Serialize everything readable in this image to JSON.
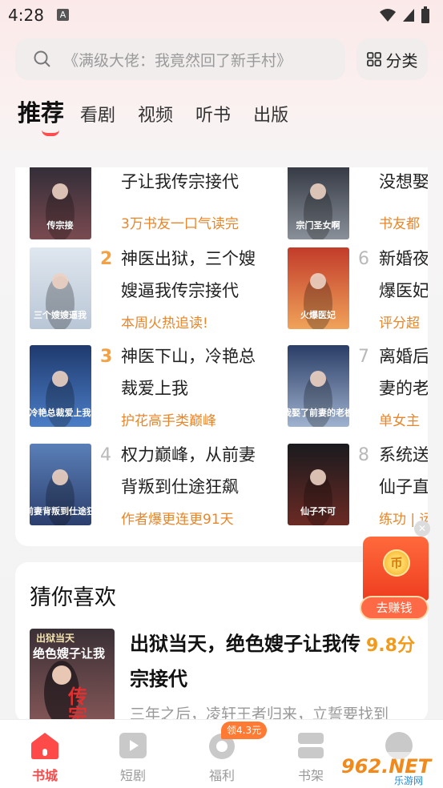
{
  "status": {
    "time": "4:28",
    "notif": "A"
  },
  "search": {
    "placeholder": "《满级大佬：我竟然回了新手村》",
    "category_label": "分类"
  },
  "tabs": [
    {
      "label": "推荐"
    },
    {
      "label": "看剧"
    },
    {
      "label": "视频"
    },
    {
      "label": "听书"
    },
    {
      "label": "出版"
    }
  ],
  "rank_left": [
    {
      "rank": "",
      "title1": "子让我传宗接代",
      "title2": "",
      "tag": "3万书友一口气读完",
      "cover_text": "传宗接",
      "cover_colors": [
        "#2a2a35",
        "#7a4a50"
      ]
    },
    {
      "rank": "2",
      "title1": "神医出狱，三个嫂",
      "title2": "嫂逼我传宗接代",
      "tag": "本周火热追读!",
      "cover_text": "三个嫂嫂逼我",
      "cover_colors": [
        "#dfe7ef",
        "#b9c6d6"
      ]
    },
    {
      "rank": "3",
      "title1": "神医下山，冷艳总",
      "title2": "裁爱上我",
      "tag": "护花高手类巅峰",
      "cover_text": "冷艳总裁爱上我",
      "cover_colors": [
        "#1f3a6e",
        "#4b7ec7"
      ]
    },
    {
      "rank": "4",
      "title1": "权力巅峰，从前妻",
      "title2": "背叛到仕途狂飙",
      "tag": "作者爆更连更91天",
      "cover_text": "从前妻背叛到仕途狂飙",
      "cover_colors": [
        "#5a7fb8",
        "#2c3f6e"
      ]
    }
  ],
  "rank_right": [
    {
      "rank": "",
      "title1": "没想娶",
      "title2": "",
      "tag": "书友都",
      "cover_text": "宗门圣女啊",
      "cover_colors": [
        "#2a2f3a",
        "#8a9099"
      ]
    },
    {
      "rank": "6",
      "title1": "新婚夜",
      "title2": "爆医妃",
      "tag": "评分超",
      "cover_text": "火爆医妃",
      "cover_colors": [
        "#c23b2a",
        "#f0a35a"
      ]
    },
    {
      "rank": "7",
      "title1": "离婚后",
      "title2": "妻的老",
      "tag": "单女主",
      "cover_text": "我娶了前妻的老板",
      "cover_colors": [
        "#2a3d66",
        "#9fb2cf"
      ]
    },
    {
      "rank": "8",
      "title1": "系统送",
      "title2": "仙子直",
      "tag": "练功 | 运",
      "cover_text": "仙子不可",
      "cover_colors": [
        "#1a1a1e",
        "#6b2a24"
      ]
    }
  ],
  "rank_colors": {
    "top3": "#f2a244",
    "other": "#b9b9b9"
  },
  "guess": {
    "section_title": "猜你喜欢",
    "book_title": "出狱当天，绝色嫂子让我传宗接代",
    "score": "9.8分",
    "desc": "三年之后，凌轩王者归来，立誓要找到",
    "cover_text_top": "出狱当天",
    "cover_text_main": "绝色嫂子让我",
    "cover_text_big": "传宗接"
  },
  "float_widget": {
    "label": "去赚钱",
    "coin": "币"
  },
  "bottom_nav": {
    "items": [
      {
        "label": "书城",
        "icon": "home-icon"
      },
      {
        "label": "短剧",
        "icon": "play-icon"
      },
      {
        "label": "福利",
        "icon": "gift-icon"
      },
      {
        "label": "书架",
        "icon": "bookshelf-icon"
      },
      {
        "label": "",
        "icon": "profile-icon"
      }
    ],
    "badge": "领4.3元",
    "accent": "#ff4a4a"
  },
  "watermark": {
    "text": "962.NET",
    "sub": "乐游网"
  }
}
